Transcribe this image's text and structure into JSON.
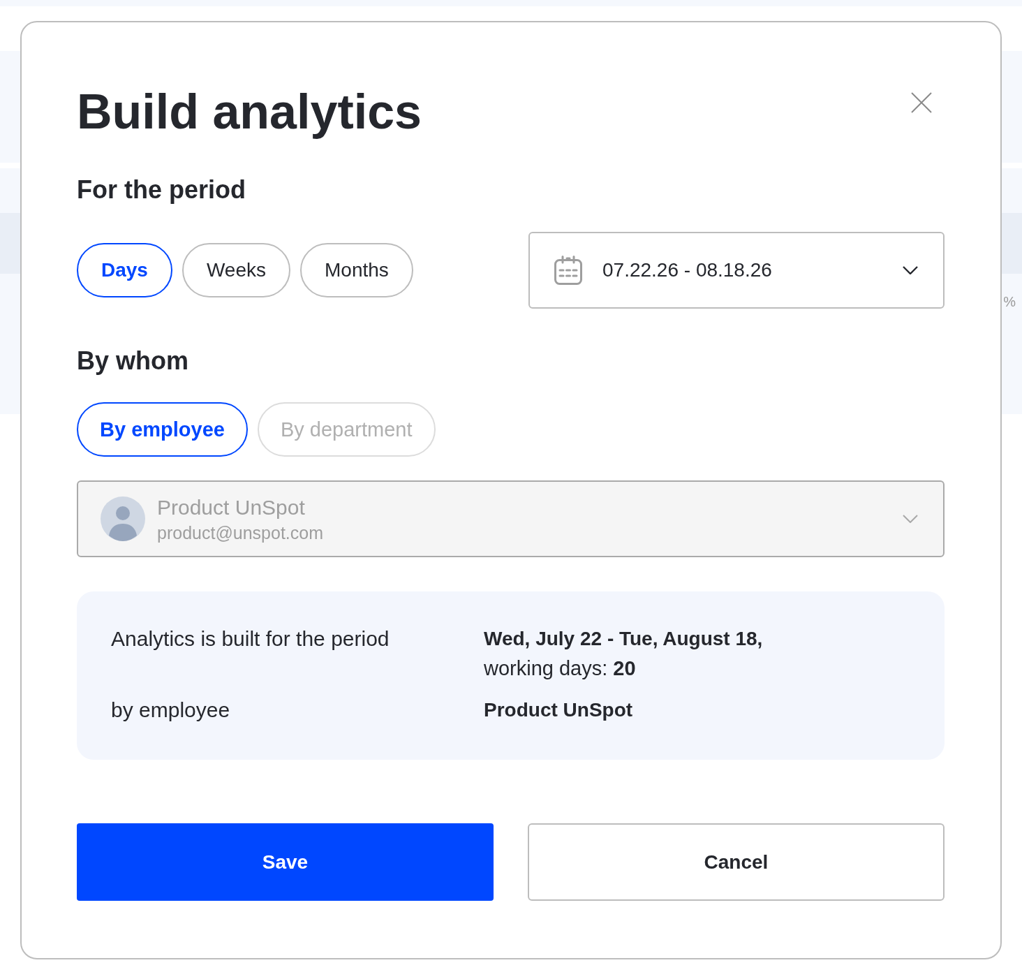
{
  "background": {
    "fragment_text": "%"
  },
  "dialog": {
    "title": "Build analytics",
    "period": {
      "heading": "For the period",
      "units": [
        {
          "label": "Days",
          "selected": true
        },
        {
          "label": "Weeks",
          "selected": false
        },
        {
          "label": "Months",
          "selected": false
        }
      ],
      "date_range": {
        "value": "07.22.26 - 08.18.26"
      }
    },
    "by_whom": {
      "heading": "By whom",
      "modes": [
        {
          "label": "By employee",
          "selected": true,
          "disabled": false
        },
        {
          "label": "By department",
          "selected": false,
          "disabled": true
        }
      ],
      "employee_select": {
        "name": "Product UnSpot",
        "email": "product@unspot.com",
        "disabled": true
      }
    },
    "summary": {
      "rows": [
        {
          "label": "Analytics is built for the period",
          "value": "Wed, July 22 - Tue, August 18,",
          "detail": "working days: **20**"
        },
        {
          "label": "by employee",
          "value": "Product UnSpot"
        }
      ]
    },
    "buttons": [
      {
        "label": "Save",
        "kind": "primary"
      },
      {
        "label": "Cancel",
        "kind": "secondary"
      }
    ]
  }
}
